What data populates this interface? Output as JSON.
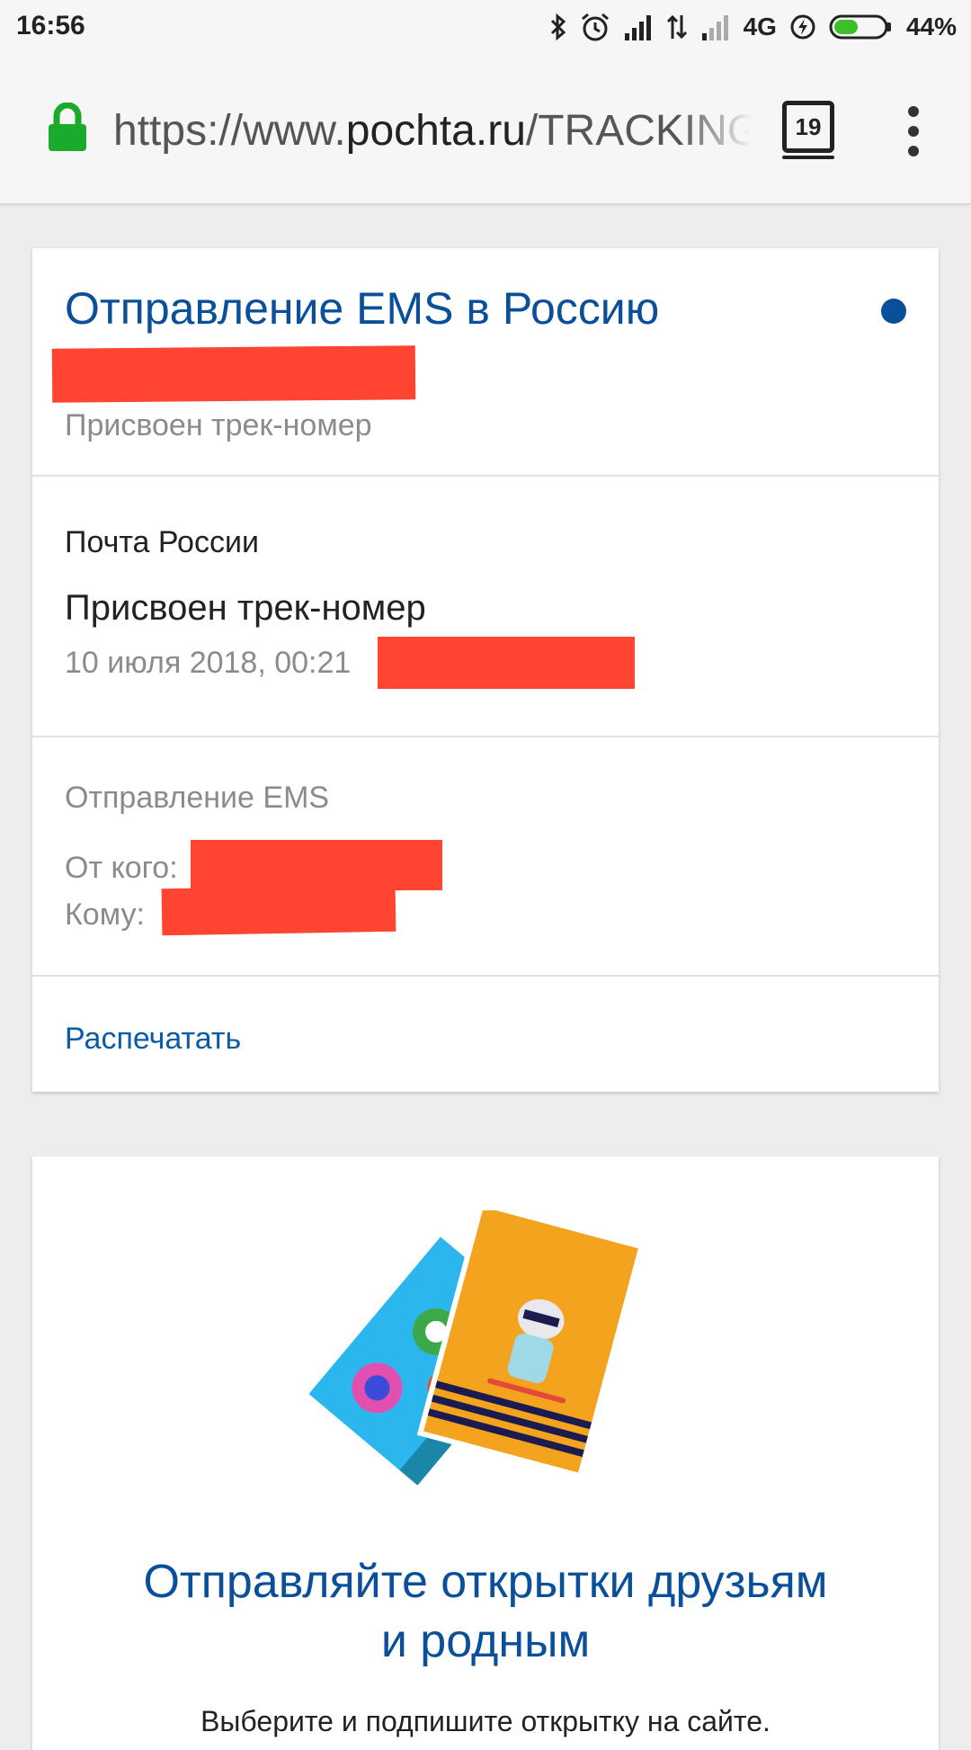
{
  "status_bar": {
    "time": "16:56",
    "network": "4G",
    "battery": "44%",
    "icons": [
      "bluetooth-icon",
      "alarm-icon",
      "signal-icon",
      "data-arrows-icon",
      "signal-weak-icon",
      "charging-icon",
      "battery-icon"
    ]
  },
  "browser": {
    "url_scheme": "https://www.",
    "url_domain": "pochta.ru",
    "url_path": "/TRACKING",
    "tab_count": "19"
  },
  "tracking": {
    "title": "Отправление EMS в Россию",
    "subtitle": "Присвоен трек-номер",
    "event_org": "Почта России",
    "event_status": "Присвоен трек-номер",
    "event_date": "10 июля 2018, 00:21",
    "shipment_type": "Отправление EMS",
    "from_label": "От кого:",
    "to_label": "Кому:",
    "print_link": "Распечатать",
    "accent_color": "#0a4f9a",
    "redaction_color": "#ff4431"
  },
  "promo": {
    "title_line1": "Отправляйте открытки друзьям",
    "title_line2": "и родным",
    "subtitle": "Выберите и подпишите открытку на сайте."
  }
}
